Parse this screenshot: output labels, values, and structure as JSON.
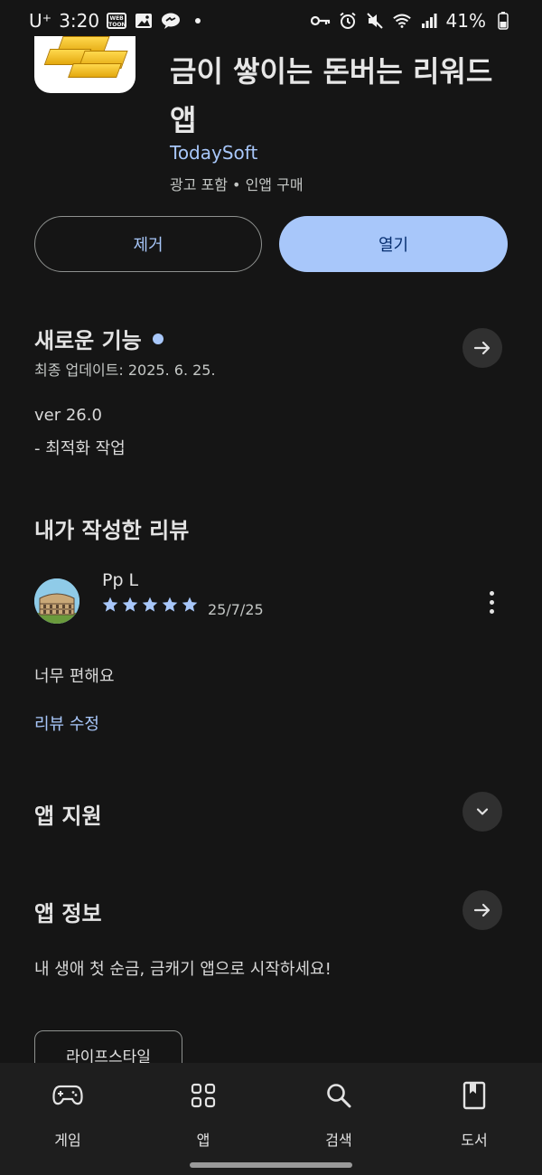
{
  "status_bar": {
    "carrier": "U⁺",
    "time": "3:20",
    "battery": "41%",
    "left_icons": [
      "webtoon-icon",
      "gallery-icon",
      "messenger-icon",
      "dot-icon"
    ],
    "right_icons": [
      "key-icon",
      "alarm-icon",
      "mute-icon",
      "wifi-icon",
      "signal-icon",
      "battery-icon"
    ]
  },
  "app": {
    "title": "금이 쌓이는 돈버는 리워드 앱",
    "developer": "TodaySoft",
    "meta": "광고 포함 • 인앱 구매"
  },
  "actions": {
    "remove_label": "제거",
    "open_label": "열기"
  },
  "whats_new": {
    "title": "새로운 기능",
    "last_updated": "최종 업데이트: 2025. 6. 25.",
    "version": "ver 26.0",
    "notes": "- 최적화 작업"
  },
  "my_review": {
    "title": "내가 작성한 리뷰",
    "reviewer": "Pp L",
    "rating": 5,
    "date": "25/7/25",
    "text": "너무 편해요",
    "edit_label": "리뷰 수정"
  },
  "app_support": {
    "title": "앱 지원"
  },
  "app_info": {
    "title": "앱 정보",
    "description": "내 생애 첫 순금, 금캐기 앱으로 시작하세요!",
    "category_chip": "라이프스타일"
  },
  "bottom_nav": {
    "items": [
      {
        "label": "게임",
        "icon": "gamepad-icon"
      },
      {
        "label": "앱",
        "icon": "apps-grid-icon"
      },
      {
        "label": "검색",
        "icon": "search-icon"
      },
      {
        "label": "도서",
        "icon": "book-icon"
      }
    ]
  },
  "colors": {
    "background": "#151515",
    "accent": "#a8c7fa",
    "star": "#a8c7fa",
    "nav_background": "#1e1e1e"
  }
}
